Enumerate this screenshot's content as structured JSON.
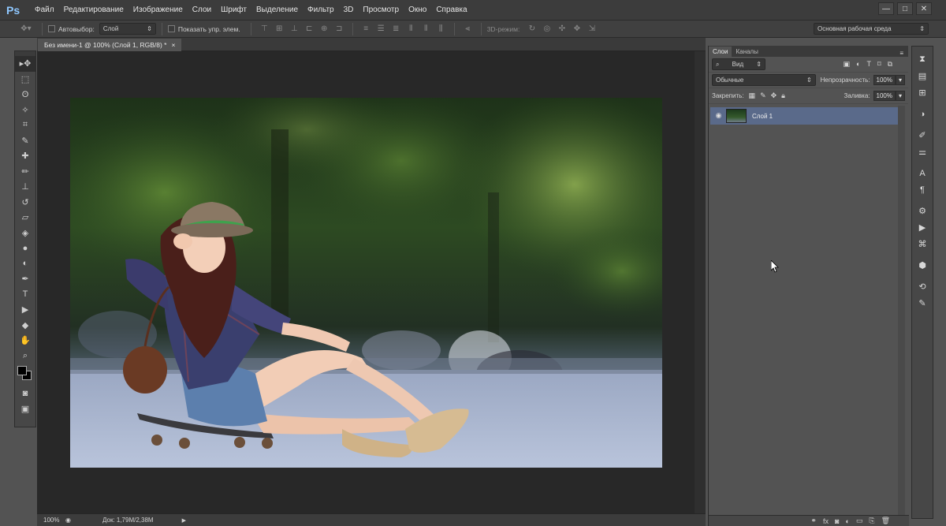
{
  "app": {
    "logo": "Ps"
  },
  "menu": [
    "Файл",
    "Редактирование",
    "Изображение",
    "Слои",
    "Шрифт",
    "Выделение",
    "Фильтр",
    "3D",
    "Просмотр",
    "Окно",
    "Справка"
  ],
  "window_controls": [
    "—",
    "□",
    "✕"
  ],
  "options": {
    "autoselect_label": "Автовыбор:",
    "autoselect_value": "Слой",
    "show_transform_label": "Показать упр. элем.",
    "mode_3d_label": "3D-режим:",
    "workspace": "Основная рабочая среда"
  },
  "document": {
    "tab_title": "Без имени-1 @ 100% (Слой 1, RGB/8) *",
    "close_glyph": "×"
  },
  "status": {
    "zoom": "100%",
    "doc_size": "Док: 1,79M/2,38M"
  },
  "layers_panel": {
    "tabs": [
      "Слои",
      "Каналы"
    ],
    "filter_kind": "Вид",
    "blend_mode": "Обычные",
    "opacity_label": "Непрозрачность:",
    "opacity_value": "100%",
    "lock_label": "Закрепить:",
    "fill_label": "Заливка:",
    "fill_value": "100%",
    "layers": [
      {
        "name": "Слой 1",
        "visible": true,
        "selected": true
      }
    ]
  },
  "colors": {
    "foreground": "#000000",
    "background": "#000000",
    "selected_layer": "#5a6a8a"
  },
  "icons": {
    "tools": [
      "move-icon",
      "marquee-icon",
      "lasso-icon",
      "magic-wand-icon",
      "crop-icon",
      "eyedropper-icon",
      "healing-brush-icon",
      "brush-icon",
      "clone-stamp-icon",
      "history-brush-icon",
      "eraser-icon",
      "paint-bucket-icon",
      "blur-icon",
      "dodge-icon",
      "pen-icon",
      "type-icon",
      "path-selection-icon",
      "shape-icon",
      "hand-icon",
      "zoom-icon"
    ],
    "dock": [
      "history-icon",
      "properties-icon",
      "adjustments-icon",
      "color-icon",
      "brushes-icon",
      "brush-presets-icon",
      "character-icon",
      "paragraph-icon",
      "tool-presets-icon",
      "actions-icon",
      "3d-icon",
      "timeline-icon",
      "measurement-icon",
      "notes-icon"
    ]
  }
}
